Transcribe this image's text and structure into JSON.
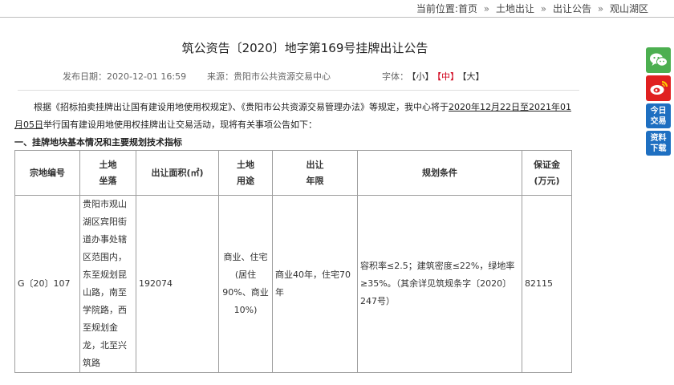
{
  "breadcrumb": {
    "prefix": "当前位置:",
    "items": [
      "首页",
      "土地出让",
      "出让公告",
      "观山湖区"
    ],
    "separator": "»"
  },
  "article": {
    "title": "筑公资告〔2020〕地字第169号挂牌出让公告",
    "publish_label": "发布日期：",
    "publish_date": "2020-12-01 16:59",
    "source_label": "来源：",
    "source_value": "贵阳市公共资源交易中心",
    "font_label": "字体：",
    "font_options": [
      "【小】",
      "【中】",
      "【大】"
    ],
    "font_selected": "【中】",
    "intro_part1": "根据《招标拍卖挂牌出让国有建设用地使用权规定》、《贵阳市公共资源交易管理办法》等规定，我中心将于",
    "intro_dates": "2020年12月22日至2021年01月05日",
    "intro_part2": "举行国有建设用地使用权挂牌出让交易活动，现将有关事项公告如下：",
    "section1_heading": "一、挂牌地块基本情况和主要规划技术指标"
  },
  "table": {
    "headers": [
      {
        "line1": "宗地编号",
        "line2": ""
      },
      {
        "line1": "土地",
        "line2": "坐落"
      },
      {
        "line1": "出让面积(㎡)",
        "line2": ""
      },
      {
        "line1": "土地",
        "line2": "用途"
      },
      {
        "line1": "出让",
        "line2": "年限"
      },
      {
        "line1": "规划条件",
        "line2": ""
      },
      {
        "line1": "保证金",
        "line2": "(万元)"
      }
    ],
    "row": {
      "plot_id": "G〔20〕107",
      "location": "贵阳市观山湖区宾阳街道办事处辖区范围内，东至规划昆山路，南至学院路，西至规划金龙，北至兴筑路",
      "area": "192074",
      "use_main": "商业、住宅",
      "use_ratio": "(居住90%、商业10%)",
      "term": "商业40年，住宅70年",
      "conditions": "容积率≤2.5；建筑密度≤22%，绿地率≥35%。（其余详见筑规条字〔2020〕247号）",
      "deposit": "82115"
    }
  },
  "floating_buttons": {
    "wechat_icon": "wechat-icon",
    "weibo_icon": "weibo-icon",
    "today_trade": "今日交易",
    "download": "资料下载",
    "wechat_color": "#4caf50",
    "weibo_color": "#e02020",
    "info_color": "#1e6fc1"
  }
}
